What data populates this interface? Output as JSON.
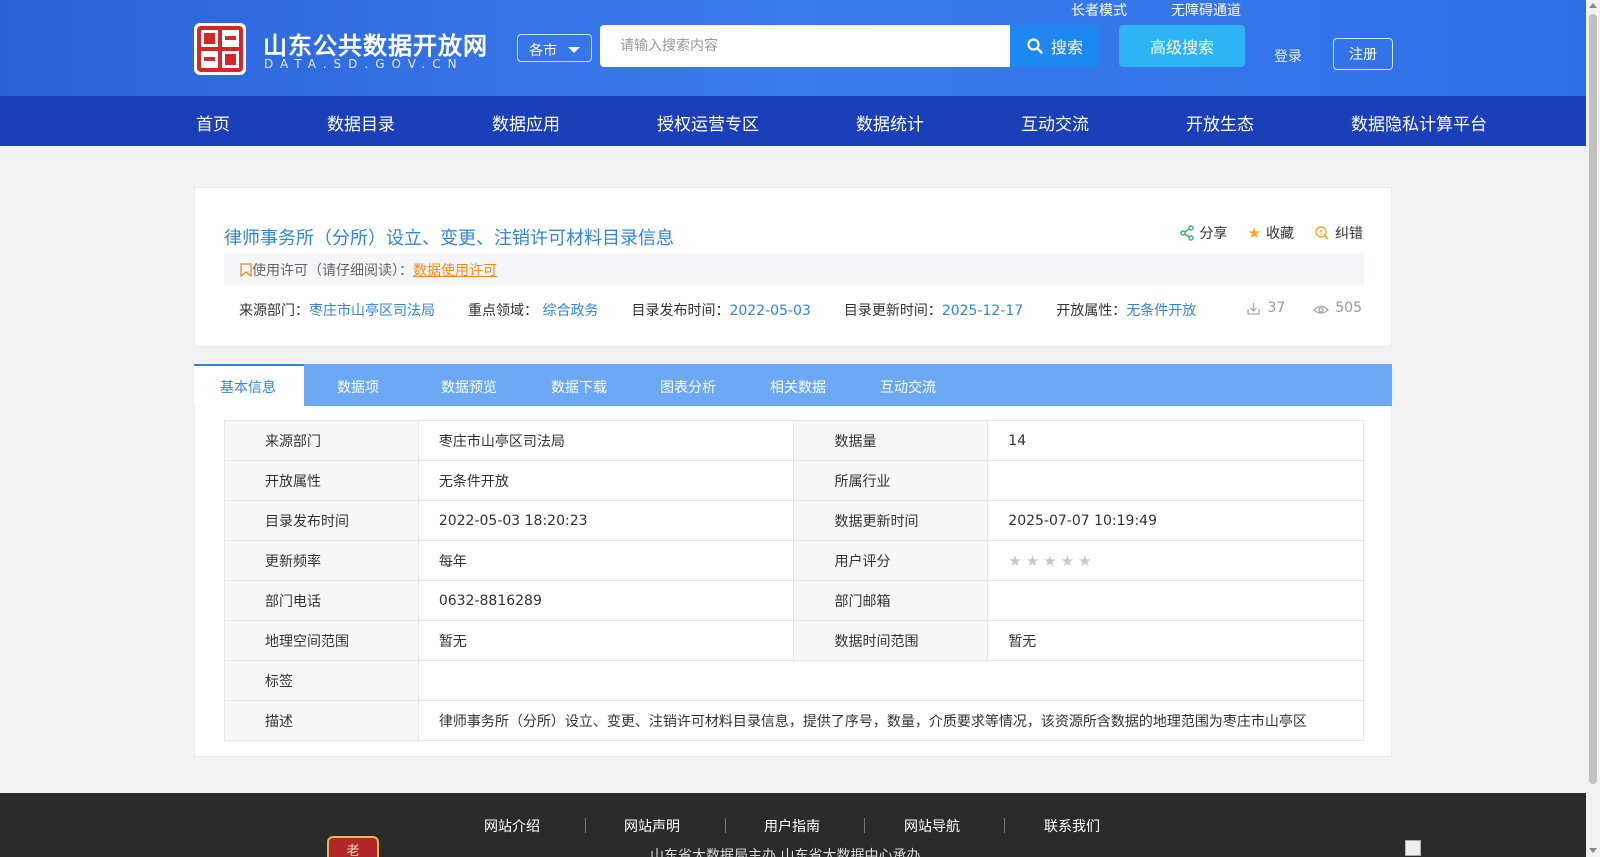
{
  "header": {
    "site_name": "山东公共数据开放网",
    "site_domain": "DATA.SD.GOV.CN",
    "city_select": "各市",
    "search_placeholder": "请输入搜索内容",
    "search_label": "搜索",
    "advanced_search_label": "高级搜索",
    "elder_mode": "长者模式",
    "accessibility": "无障碍通道",
    "login": "登录",
    "register": "注册"
  },
  "nav": {
    "items": [
      "首页",
      "数据目录",
      "数据应用",
      "授权运营专区",
      "数据统计",
      "互动交流",
      "开放生态",
      "数据隐私计算平台"
    ]
  },
  "dataset": {
    "title": "律师事务所（分所）设立、变更、注销许可材料目录信息",
    "actions": {
      "share": "分享",
      "favorite": "收藏",
      "report": "纠错"
    },
    "license_text": "使用许可（请仔细阅读）：",
    "license_link": "数据使用许可",
    "meta": {
      "source_label": "来源部门：",
      "source_value": "枣庄市山亭区司法局",
      "domain_label": "重点领域：",
      "domain_value": "综合政务",
      "publish_label": "目录发布时间：",
      "publish_value": "2022-05-03",
      "update_label": "目录更新时间：",
      "update_value": "2025-12-17",
      "open_label": "开放属性：",
      "open_value": "无条件开放"
    },
    "downloads": "37",
    "views": "505"
  },
  "tabs": [
    "基本信息",
    "数据项",
    "数据预览",
    "数据下载",
    "图表分析",
    "相关数据",
    "互动交流"
  ],
  "info": {
    "rows": [
      {
        "k1": "来源部门",
        "v1": "枣庄市山亭区司法局",
        "k2": "数据量",
        "v2": "14"
      },
      {
        "k1": "开放属性",
        "v1": "无条件开放",
        "k2": "所属行业",
        "v2": ""
      },
      {
        "k1": "目录发布时间",
        "v1": "2022-05-03 18:20:23",
        "k2": "数据更新时间",
        "v2": "2025-07-07 10:19:49"
      },
      {
        "k1": "更新频率",
        "v1": "每年",
        "k2": "用户评分",
        "v2": ""
      },
      {
        "k1": "部门电话",
        "v1": "0632-8816289",
        "k2": "部门邮箱",
        "v2": ""
      },
      {
        "k1": "地理空间范围",
        "v1": "暂无",
        "k2": "数据时间范围",
        "v2": "暂无"
      }
    ],
    "rating": 0,
    "tag_label": "标签",
    "tag_value": "",
    "desc_label": "描述",
    "desc_value": "律师事务所（分所）设立、变更、注销许可材料目录信息，提供了序号，数量，介质要求等情况，该资源所含数据的地理范围为枣庄市山亭区"
  },
  "footer": {
    "links": [
      "网站介绍",
      "网站声明",
      "用户指南",
      "网站导航",
      "联系我们"
    ],
    "sub": "山东省大数据局主办   山东省大数据中心承办",
    "badge": "老"
  }
}
